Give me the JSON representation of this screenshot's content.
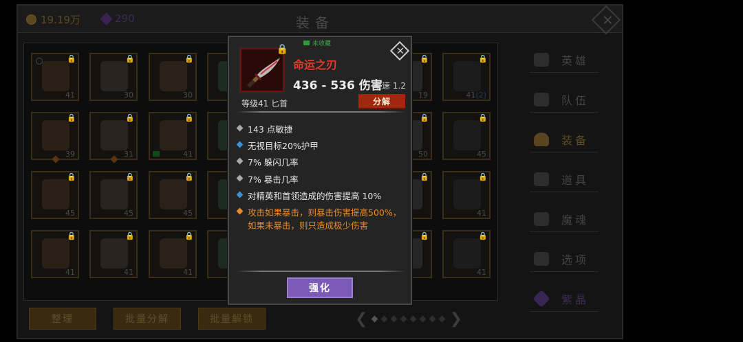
{
  "header": {
    "coins": "19.19万",
    "gems": "290",
    "title": "装备"
  },
  "inventory": [
    {
      "level": "41",
      "lock": true,
      "circle": true
    },
    {
      "level": "30",
      "lock": true
    },
    {
      "level": "30",
      "lock": true
    },
    {
      "level": "",
      "lock": true
    },
    {
      "level": "",
      "lock": false
    },
    {
      "level": "",
      "lock": false
    },
    {
      "level": "19",
      "lock": true
    },
    {
      "level": "41",
      "lock": true,
      "extra": "(2)"
    },
    {
      "level": "39",
      "lock": true,
      "dot": true
    },
    {
      "level": "31",
      "lock": true,
      "dot": true
    },
    {
      "level": "41",
      "lock": true,
      "book": true
    },
    {
      "level": "",
      "lock": true
    },
    {
      "level": "",
      "lock": false
    },
    {
      "level": "",
      "lock": false
    },
    {
      "level": "50",
      "lock": true
    },
    {
      "level": "45",
      "lock": true
    },
    {
      "level": "45",
      "lock": true
    },
    {
      "level": "45",
      "lock": true
    },
    {
      "level": "45",
      "lock": true
    },
    {
      "level": "",
      "lock": true
    },
    {
      "level": "",
      "lock": false
    },
    {
      "level": "",
      "lock": false
    },
    {
      "level": "",
      "lock": true
    },
    {
      "level": "41",
      "lock": true
    },
    {
      "level": "41",
      "lock": true
    },
    {
      "level": "41",
      "lock": true
    },
    {
      "level": "41",
      "lock": true
    },
    {
      "level": "",
      "lock": true
    },
    {
      "level": "",
      "lock": false
    },
    {
      "level": "",
      "lock": false
    },
    {
      "level": "",
      "lock": true
    },
    {
      "level": "41",
      "lock": true
    }
  ],
  "menu": [
    {
      "label": "英雄",
      "icon": "heroes-icon"
    },
    {
      "label": "队伍",
      "icon": "flag-icon"
    },
    {
      "label": "装备",
      "icon": "helmet-icon",
      "active": true
    },
    {
      "label": "道具",
      "icon": "bag-icon"
    },
    {
      "label": "魔魂",
      "icon": "flame-icon"
    },
    {
      "label": "选项",
      "icon": "gear-icon"
    },
    {
      "label": "紫晶",
      "icon": "crystal-icon"
    }
  ],
  "bottom": {
    "sort": "整理",
    "batch_decompose": "批量分解",
    "batch_unlock": "批量解锁"
  },
  "pager": {
    "pages": 8,
    "current": 1
  },
  "popup": {
    "collect_label": "未收藏",
    "name": "命运之刃",
    "damage": "436 - 536 伤害",
    "speed": "攻速 1.2",
    "level_type": "等级41 匕首",
    "decompose": "分解",
    "stats": [
      {
        "text": "143 点敏捷",
        "kind": "grey"
      },
      {
        "text": "无视目标20%护甲",
        "kind": "blue"
      },
      {
        "text": "7% 躲闪几率",
        "kind": "grey"
      },
      {
        "text": "7% 暴击几率",
        "kind": "grey"
      },
      {
        "text": "对精英和首领造成的伤害提高 10%",
        "kind": "blue"
      },
      {
        "text": "攻击如果暴击，则暴击伤害提高500%，如果未暴击，则只造成极少伤害",
        "kind": "orange"
      }
    ],
    "upgrade": "强化"
  },
  "colors": {
    "item_name": "#e23a2c",
    "decompose_button": "#a3260f",
    "upgrade_button": "#7b5ab8",
    "rare_stat": "#3d8fd6",
    "legendary_stat": "#e88a2a"
  }
}
